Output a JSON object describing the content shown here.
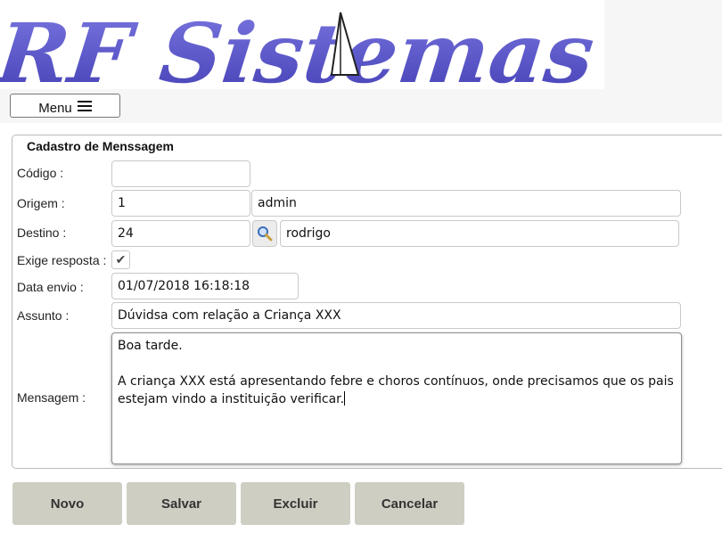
{
  "header": {
    "logo_text": "RF Sistemas",
    "menu_label": "Menu"
  },
  "form": {
    "title": "Cadastro de Menssagem",
    "codigo": {
      "label": "Código :",
      "value": ""
    },
    "origem": {
      "label": "Origem :",
      "id": "1",
      "name": "admin"
    },
    "destino": {
      "label": "Destino :",
      "id": "24",
      "name": "rodrigo"
    },
    "exige_resposta": {
      "label": "Exige resposta :",
      "checked": true,
      "mark": "✔"
    },
    "data_envio": {
      "label": "Data envio :",
      "value": "01/07/2018 16:18:18"
    },
    "assunto": {
      "label": "Assunto :",
      "value": "Dúvidsa com relação a Criança XXX"
    },
    "mensagem": {
      "label": "Mensagem :",
      "value": "Boa tarde.\n\nA criança XXX está apresentando febre e choros contínuos, onde precisamos que os pais estejam vindo a instituição verificar."
    }
  },
  "buttons": {
    "novo": "Novo",
    "salvar": "Salvar",
    "excluir": "Excluir",
    "cancelar": "Cancelar"
  },
  "colors": {
    "logo": "#5b57c8",
    "button_bg": "#cfcec3"
  },
  "icons": {
    "menu": "hamburger-icon",
    "search": "magnifier-icon",
    "check": "checkmark-icon"
  }
}
